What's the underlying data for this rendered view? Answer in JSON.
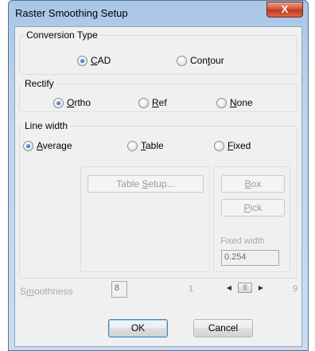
{
  "window": {
    "title": "Raster Smoothing Setup",
    "close_label": "X"
  },
  "conversion_type": {
    "label": "Conversion Type",
    "options": [
      {
        "pre": "",
        "key": "C",
        "post": "AD",
        "selected": true
      },
      {
        "pre": "Con",
        "key": "t",
        "post": "our",
        "selected": false
      }
    ]
  },
  "rectify": {
    "label": "Rectify",
    "options": [
      {
        "pre": "",
        "key": "O",
        "post": "rtho",
        "selected": true
      },
      {
        "pre": "",
        "key": "R",
        "post": "ef",
        "selected": false
      },
      {
        "pre": "",
        "key": "N",
        "post": "one",
        "selected": false
      }
    ]
  },
  "line_width": {
    "label": "Line width",
    "options": [
      {
        "pre": "",
        "key": "A",
        "post": "verage",
        "selected": true
      },
      {
        "pre": "",
        "key": "T",
        "post": "able",
        "selected": false
      },
      {
        "pre": "",
        "key": "F",
        "post": "ixed",
        "selected": false
      }
    ],
    "table_setup": {
      "pre": "Table ",
      "key": "S",
      "post": "etup..."
    },
    "box_button": {
      "pre": "",
      "key": "B",
      "post": "ox"
    },
    "pick_button": {
      "pre": "",
      "key": "P",
      "post": "ick"
    },
    "fixed_width_label": "Fixed width",
    "fixed_width_value": "0.254"
  },
  "smoothness": {
    "label_pre": "S",
    "label_key": "m",
    "label_post": "oothness",
    "value": "8",
    "min": "1",
    "max": "9"
  },
  "buttons": {
    "ok": "OK",
    "cancel": "Cancel"
  }
}
